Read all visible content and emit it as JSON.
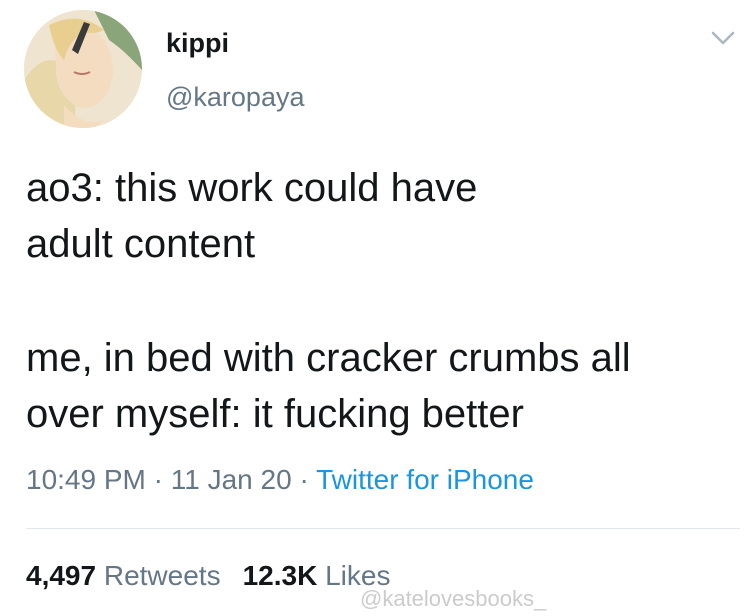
{
  "tweet": {
    "display_name": "kippi",
    "handle": "@karopaya",
    "text_line_1": "ao3: this work could have",
    "text_line_2": "adult content",
    "text_line_3": "me, in bed with cracker crumbs all",
    "text_line_4": "over myself: it fucking better",
    "time": "10:49 PM",
    "date": "11 Jan 20",
    "separator": "·",
    "source": "Twitter for iPhone",
    "retweets_count": "4,497",
    "retweets_label": "Retweets",
    "likes_count": "12.3K",
    "likes_label": "Likes"
  },
  "watermark": "@katelovesbooks_",
  "icons": {
    "menu": "chevron-down-icon",
    "avatar": "avatar-illustration"
  },
  "colors": {
    "text": "#14171a",
    "secondary": "#657786",
    "link": "#1b95e0",
    "divider": "#e1e8ed"
  }
}
